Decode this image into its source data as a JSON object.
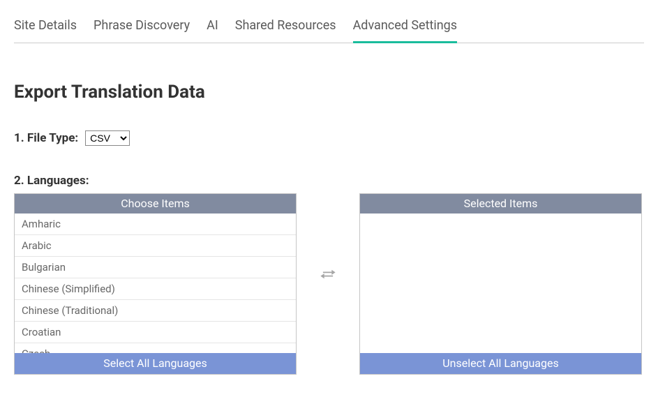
{
  "tabs": [
    {
      "label": "Site Details",
      "active": false
    },
    {
      "label": "Phrase Discovery",
      "active": false
    },
    {
      "label": "AI",
      "active": false
    },
    {
      "label": "Shared Resources",
      "active": false
    },
    {
      "label": "Advanced Settings",
      "active": true
    }
  ],
  "page_title": "Export Translation Data",
  "file_type_label": "1. File Type:",
  "file_type_options": [
    "CSV"
  ],
  "file_type_selected": "CSV",
  "languages_label": "2. Languages:",
  "choose_panel_header": "Choose Items",
  "selected_panel_header": "Selected Items",
  "select_all_label": "Select All Languages",
  "unselect_all_label": "Unselect All Languages",
  "available_languages": [
    "Amharic",
    "Arabic",
    "Bulgarian",
    "Chinese (Simplified)",
    "Chinese (Traditional)",
    "Croatian",
    "Czech"
  ],
  "selected_languages": []
}
